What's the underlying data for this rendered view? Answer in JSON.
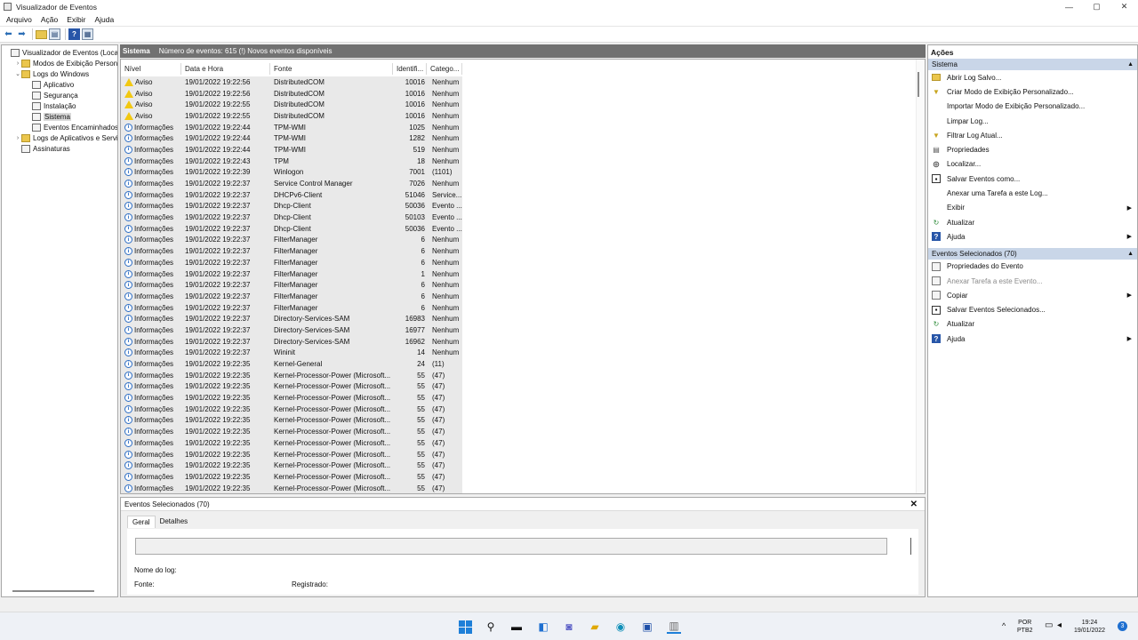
{
  "window": {
    "title": "Visualizador de Eventos",
    "minimize": "—",
    "maximize": "▢",
    "close": "✕"
  },
  "menu": [
    "Arquivo",
    "Ação",
    "Exibir",
    "Ajuda"
  ],
  "tree": [
    {
      "label": "Visualizador de Eventos (Local)",
      "indent": 0,
      "exp": "",
      "icon": "log",
      "name": "tree-root"
    },
    {
      "label": "Modos de Exibição Personalizados",
      "indent": 1,
      "exp": "›",
      "icon": "folder",
      "name": "tree-custom-views"
    },
    {
      "label": "Logs do Windows",
      "indent": 1,
      "exp": "⌄",
      "icon": "folder",
      "name": "tree-windows-logs"
    },
    {
      "label": "Aplicativo",
      "indent": 2,
      "exp": "",
      "icon": "log",
      "name": "tree-application"
    },
    {
      "label": "Segurança",
      "indent": 2,
      "exp": "",
      "icon": "log",
      "name": "tree-security"
    },
    {
      "label": "Instalação",
      "indent": 2,
      "exp": "",
      "icon": "log",
      "name": "tree-setup"
    },
    {
      "label": "Sistema",
      "indent": 2,
      "exp": "",
      "icon": "log",
      "name": "tree-system",
      "selected": true
    },
    {
      "label": "Eventos Encaminhados",
      "indent": 2,
      "exp": "",
      "icon": "log",
      "name": "tree-forwarded"
    },
    {
      "label": "Logs de Aplicativos e Serviços",
      "indent": 1,
      "exp": "›",
      "icon": "folder",
      "name": "tree-app-services-logs"
    },
    {
      "label": "Assinaturas",
      "indent": 1,
      "exp": "",
      "icon": "log",
      "name": "tree-subscriptions"
    }
  ],
  "center": {
    "log_name": "Sistema",
    "summary": "Número de eventos: 615 (!) Novos eventos disponíveis"
  },
  "columns": [
    "Nível",
    "Data e Hora",
    "Fonte",
    "Identifi...",
    "Catego..."
  ],
  "events": [
    {
      "level": "Aviso",
      "type": "warn",
      "date": "19/01/2022 19:22:56",
      "source": "DistributedCOM",
      "id": "10016",
      "cat": "Nenhum"
    },
    {
      "level": "Aviso",
      "type": "warn",
      "date": "19/01/2022 19:22:56",
      "source": "DistributedCOM",
      "id": "10016",
      "cat": "Nenhum"
    },
    {
      "level": "Aviso",
      "type": "warn",
      "date": "19/01/2022 19:22:55",
      "source": "DistributedCOM",
      "id": "10016",
      "cat": "Nenhum"
    },
    {
      "level": "Aviso",
      "type": "warn",
      "date": "19/01/2022 19:22:55",
      "source": "DistributedCOM",
      "id": "10016",
      "cat": "Nenhum"
    },
    {
      "level": "Informações",
      "type": "info",
      "date": "19/01/2022 19:22:44",
      "source": "TPM-WMI",
      "id": "1025",
      "cat": "Nenhum"
    },
    {
      "level": "Informações",
      "type": "info",
      "date": "19/01/2022 19:22:44",
      "source": "TPM-WMI",
      "id": "1282",
      "cat": "Nenhum"
    },
    {
      "level": "Informações",
      "type": "info",
      "date": "19/01/2022 19:22:44",
      "source": "TPM-WMI",
      "id": "519",
      "cat": "Nenhum"
    },
    {
      "level": "Informações",
      "type": "info",
      "date": "19/01/2022 19:22:43",
      "source": "TPM",
      "id": "18",
      "cat": "Nenhum"
    },
    {
      "level": "Informações",
      "type": "info",
      "date": "19/01/2022 19:22:39",
      "source": "Winlogon",
      "id": "7001",
      "cat": "(1101)"
    },
    {
      "level": "Informações",
      "type": "info",
      "date": "19/01/2022 19:22:37",
      "source": "Service Control Manager",
      "id": "7026",
      "cat": "Nenhum"
    },
    {
      "level": "Informações",
      "type": "info",
      "date": "19/01/2022 19:22:37",
      "source": "DHCPv6-Client",
      "id": "51046",
      "cat": "Service..."
    },
    {
      "level": "Informações",
      "type": "info",
      "date": "19/01/2022 19:22:37",
      "source": "Dhcp-Client",
      "id": "50036",
      "cat": "Evento ..."
    },
    {
      "level": "Informações",
      "type": "info",
      "date": "19/01/2022 19:22:37",
      "source": "Dhcp-Client",
      "id": "50103",
      "cat": "Evento ..."
    },
    {
      "level": "Informações",
      "type": "info",
      "date": "19/01/2022 19:22:37",
      "source": "Dhcp-Client",
      "id": "50036",
      "cat": "Evento ..."
    },
    {
      "level": "Informações",
      "type": "info",
      "date": "19/01/2022 19:22:37",
      "source": "FilterManager",
      "id": "6",
      "cat": "Nenhum"
    },
    {
      "level": "Informações",
      "type": "info",
      "date": "19/01/2022 19:22:37",
      "source": "FilterManager",
      "id": "6",
      "cat": "Nenhum"
    },
    {
      "level": "Informações",
      "type": "info",
      "date": "19/01/2022 19:22:37",
      "source": "FilterManager",
      "id": "6",
      "cat": "Nenhum"
    },
    {
      "level": "Informações",
      "type": "info",
      "date": "19/01/2022 19:22:37",
      "source": "FilterManager",
      "id": "1",
      "cat": "Nenhum"
    },
    {
      "level": "Informações",
      "type": "info",
      "date": "19/01/2022 19:22:37",
      "source": "FilterManager",
      "id": "6",
      "cat": "Nenhum"
    },
    {
      "level": "Informações",
      "type": "info",
      "date": "19/01/2022 19:22:37",
      "source": "FilterManager",
      "id": "6",
      "cat": "Nenhum"
    },
    {
      "level": "Informações",
      "type": "info",
      "date": "19/01/2022 19:22:37",
      "source": "FilterManager",
      "id": "6",
      "cat": "Nenhum"
    },
    {
      "level": "Informações",
      "type": "info",
      "date": "19/01/2022 19:22:37",
      "source": "Directory-Services-SAM",
      "id": "16983",
      "cat": "Nenhum"
    },
    {
      "level": "Informações",
      "type": "info",
      "date": "19/01/2022 19:22:37",
      "source": "Directory-Services-SAM",
      "id": "16977",
      "cat": "Nenhum"
    },
    {
      "level": "Informações",
      "type": "info",
      "date": "19/01/2022 19:22:37",
      "source": "Directory-Services-SAM",
      "id": "16962",
      "cat": "Nenhum"
    },
    {
      "level": "Informações",
      "type": "info",
      "date": "19/01/2022 19:22:37",
      "source": "Wininit",
      "id": "14",
      "cat": "Nenhum"
    },
    {
      "level": "Informações",
      "type": "info",
      "date": "19/01/2022 19:22:35",
      "source": "Kernel-General",
      "id": "24",
      "cat": "(11)"
    },
    {
      "level": "Informações",
      "type": "info",
      "date": "19/01/2022 19:22:35",
      "source": "Kernel-Processor-Power (Microsoft...",
      "id": "55",
      "cat": "(47)"
    },
    {
      "level": "Informações",
      "type": "info",
      "date": "19/01/2022 19:22:35",
      "source": "Kernel-Processor-Power (Microsoft...",
      "id": "55",
      "cat": "(47)"
    },
    {
      "level": "Informações",
      "type": "info",
      "date": "19/01/2022 19:22:35",
      "source": "Kernel-Processor-Power (Microsoft...",
      "id": "55",
      "cat": "(47)"
    },
    {
      "level": "Informações",
      "type": "info",
      "date": "19/01/2022 19:22:35",
      "source": "Kernel-Processor-Power (Microsoft...",
      "id": "55",
      "cat": "(47)"
    },
    {
      "level": "Informações",
      "type": "info",
      "date": "19/01/2022 19:22:35",
      "source": "Kernel-Processor-Power (Microsoft...",
      "id": "55",
      "cat": "(47)"
    },
    {
      "level": "Informações",
      "type": "info",
      "date": "19/01/2022 19:22:35",
      "source": "Kernel-Processor-Power (Microsoft...",
      "id": "55",
      "cat": "(47)"
    },
    {
      "level": "Informações",
      "type": "info",
      "date": "19/01/2022 19:22:35",
      "source": "Kernel-Processor-Power (Microsoft...",
      "id": "55",
      "cat": "(47)"
    },
    {
      "level": "Informações",
      "type": "info",
      "date": "19/01/2022 19:22:35",
      "source": "Kernel-Processor-Power (Microsoft...",
      "id": "55",
      "cat": "(47)"
    },
    {
      "level": "Informações",
      "type": "info",
      "date": "19/01/2022 19:22:35",
      "source": "Kernel-Processor-Power (Microsoft...",
      "id": "55",
      "cat": "(47)"
    },
    {
      "level": "Informações",
      "type": "info",
      "date": "19/01/2022 19:22:35",
      "source": "Kernel-Processor-Power (Microsoft...",
      "id": "55",
      "cat": "(47)"
    },
    {
      "level": "Informações",
      "type": "info",
      "date": "19/01/2022 19:22:35",
      "source": "Kernel-Processor-Power (Microsoft...",
      "id": "55",
      "cat": "(47)"
    }
  ],
  "detail": {
    "title": "Eventos Selecionados (70)",
    "close": "✕",
    "tab_general": "Geral",
    "tab_details": "Detalhes",
    "log_name_label": "Nome do log:",
    "source_label": "Fonte:",
    "logged_label": "Registrado:"
  },
  "actions": {
    "header": "Ações",
    "section1": "Sistema",
    "items1": [
      {
        "label": "Abrir Log Salvo...",
        "icon": "folder",
        "name": "action-open-saved-log"
      },
      {
        "label": "Criar Modo de Exibição Personalizado...",
        "icon": "filter",
        "name": "action-create-custom-view"
      },
      {
        "label": "Importar Modo de Exibição Personalizado...",
        "icon": "",
        "name": "action-import-custom-view"
      },
      {
        "label": "Limpar Log...",
        "icon": "",
        "name": "action-clear-log"
      },
      {
        "label": "Filtrar Log Atual...",
        "icon": "filter",
        "name": "action-filter-log"
      },
      {
        "label": "Propriedades",
        "icon": "props",
        "name": "action-properties"
      },
      {
        "label": "Localizar...",
        "icon": "find",
        "name": "action-find"
      },
      {
        "label": "Salvar Eventos como...",
        "icon": "save",
        "name": "action-save-events-as"
      },
      {
        "label": "Anexar uma Tarefa a este Log...",
        "icon": "",
        "name": "action-attach-task-log"
      },
      {
        "label": "Exibir",
        "icon": "",
        "arrow": true,
        "name": "action-view"
      },
      {
        "label": "Atualizar",
        "icon": "refresh",
        "name": "action-refresh"
      },
      {
        "label": "Ajuda",
        "icon": "help",
        "arrow": true,
        "name": "action-help"
      }
    ],
    "section2": "Eventos Selecionados (70)",
    "items2": [
      {
        "label": "Propriedades do Evento",
        "icon": "doc",
        "name": "action-event-properties"
      },
      {
        "label": "Anexar Tarefa a este Evento...",
        "icon": "doc",
        "dim": true,
        "name": "action-attach-task-event"
      },
      {
        "label": "Copiar",
        "icon": "doc",
        "arrow": true,
        "name": "action-copy"
      },
      {
        "label": "Salvar Eventos Selecionados...",
        "icon": "save",
        "name": "action-save-selected"
      },
      {
        "label": "Atualizar",
        "icon": "refresh",
        "name": "action-refresh-2"
      },
      {
        "label": "Ajuda",
        "icon": "help",
        "arrow": true,
        "name": "action-help-2"
      }
    ]
  },
  "taskbar": {
    "lang": "POR",
    "layout": "PTB2",
    "time": "19:24",
    "date": "19/01/2022",
    "notifications": "3"
  },
  "colors": {
    "accent": "#1e7fd8",
    "section_bg": "#c9d6e8",
    "header_bg": "#717171",
    "warn": "#f2c811",
    "info": "#2b6cc4"
  }
}
